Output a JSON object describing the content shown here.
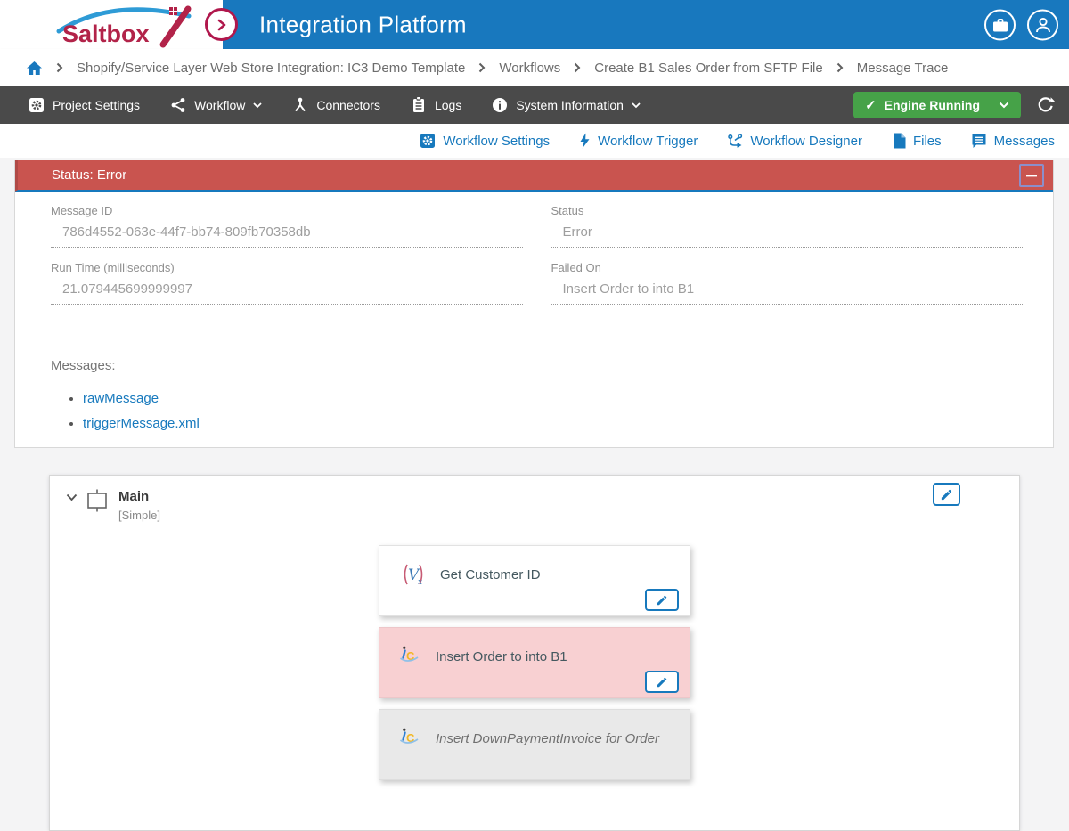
{
  "brand": {
    "name": "Saltbox"
  },
  "header": {
    "title": "Integration Platform",
    "actions": [
      {
        "icon": "briefcase-icon"
      },
      {
        "icon": "user-icon"
      }
    ]
  },
  "breadcrumb": {
    "items": [
      "Shopify/Service Layer Web Store Integration: IC3 Demo Template",
      "Workflows",
      "Create B1 Sales Order from SFTP File",
      "Message Trace"
    ]
  },
  "toolbar": {
    "items": [
      {
        "label": "Project Settings",
        "icon": "settings-icon",
        "dropdown": false
      },
      {
        "label": "Workflow",
        "icon": "share-icon",
        "dropdown": true
      },
      {
        "label": "Connectors",
        "icon": "connector-icon",
        "dropdown": false
      },
      {
        "label": "Logs",
        "icon": "logs-icon",
        "dropdown": false
      },
      {
        "label": "System Information",
        "icon": "info-icon",
        "dropdown": true
      }
    ],
    "engine": {
      "label": "Engine Running",
      "check": "✓"
    }
  },
  "tabs": [
    {
      "label": "Workflow Settings",
      "icon": "settings-icon"
    },
    {
      "label": "Workflow Trigger",
      "icon": "lightning-icon"
    },
    {
      "label": "Workflow Designer",
      "icon": "branch-icon"
    },
    {
      "label": "Files",
      "icon": "file-icon"
    },
    {
      "label": "Messages",
      "icon": "message-icon"
    }
  ],
  "status_panel": {
    "title": "Status: Error",
    "fields": [
      {
        "label": "Message ID",
        "value": "786d4552-063e-44f7-bb74-809fb70358db"
      },
      {
        "label": "Status",
        "value": "Error"
      },
      {
        "label": "Run Time (milliseconds)",
        "value": "21.079445699999997"
      },
      {
        "label": "Failed On",
        "value": "Insert Order to into B1"
      }
    ],
    "messages_heading": "Messages:",
    "links": [
      "rawMessage",
      "triggerMessage.xml"
    ]
  },
  "designer": {
    "group_name": "Main",
    "group_type": "[Simple]",
    "steps": [
      {
        "label": "Get Customer ID",
        "state": "default",
        "icon": "variable-icon"
      },
      {
        "label": "Insert Order to into B1",
        "state": "error",
        "icon": "connector-logo-icon"
      },
      {
        "label": "Insert DownPaymentInvoice for Order",
        "state": "disabled",
        "icon": "connector-logo-icon"
      }
    ]
  },
  "colors": {
    "header_blue": "#1878BE",
    "accent_blue": "#1779BD",
    "brand_crimson": "#B22349",
    "toolbar_dark": "#4A4A4A",
    "engine_green": "#46A248",
    "error_red": "#C9544F",
    "error_pink": "#F8D0D2",
    "disabled_gray": "#E9E9E9"
  }
}
